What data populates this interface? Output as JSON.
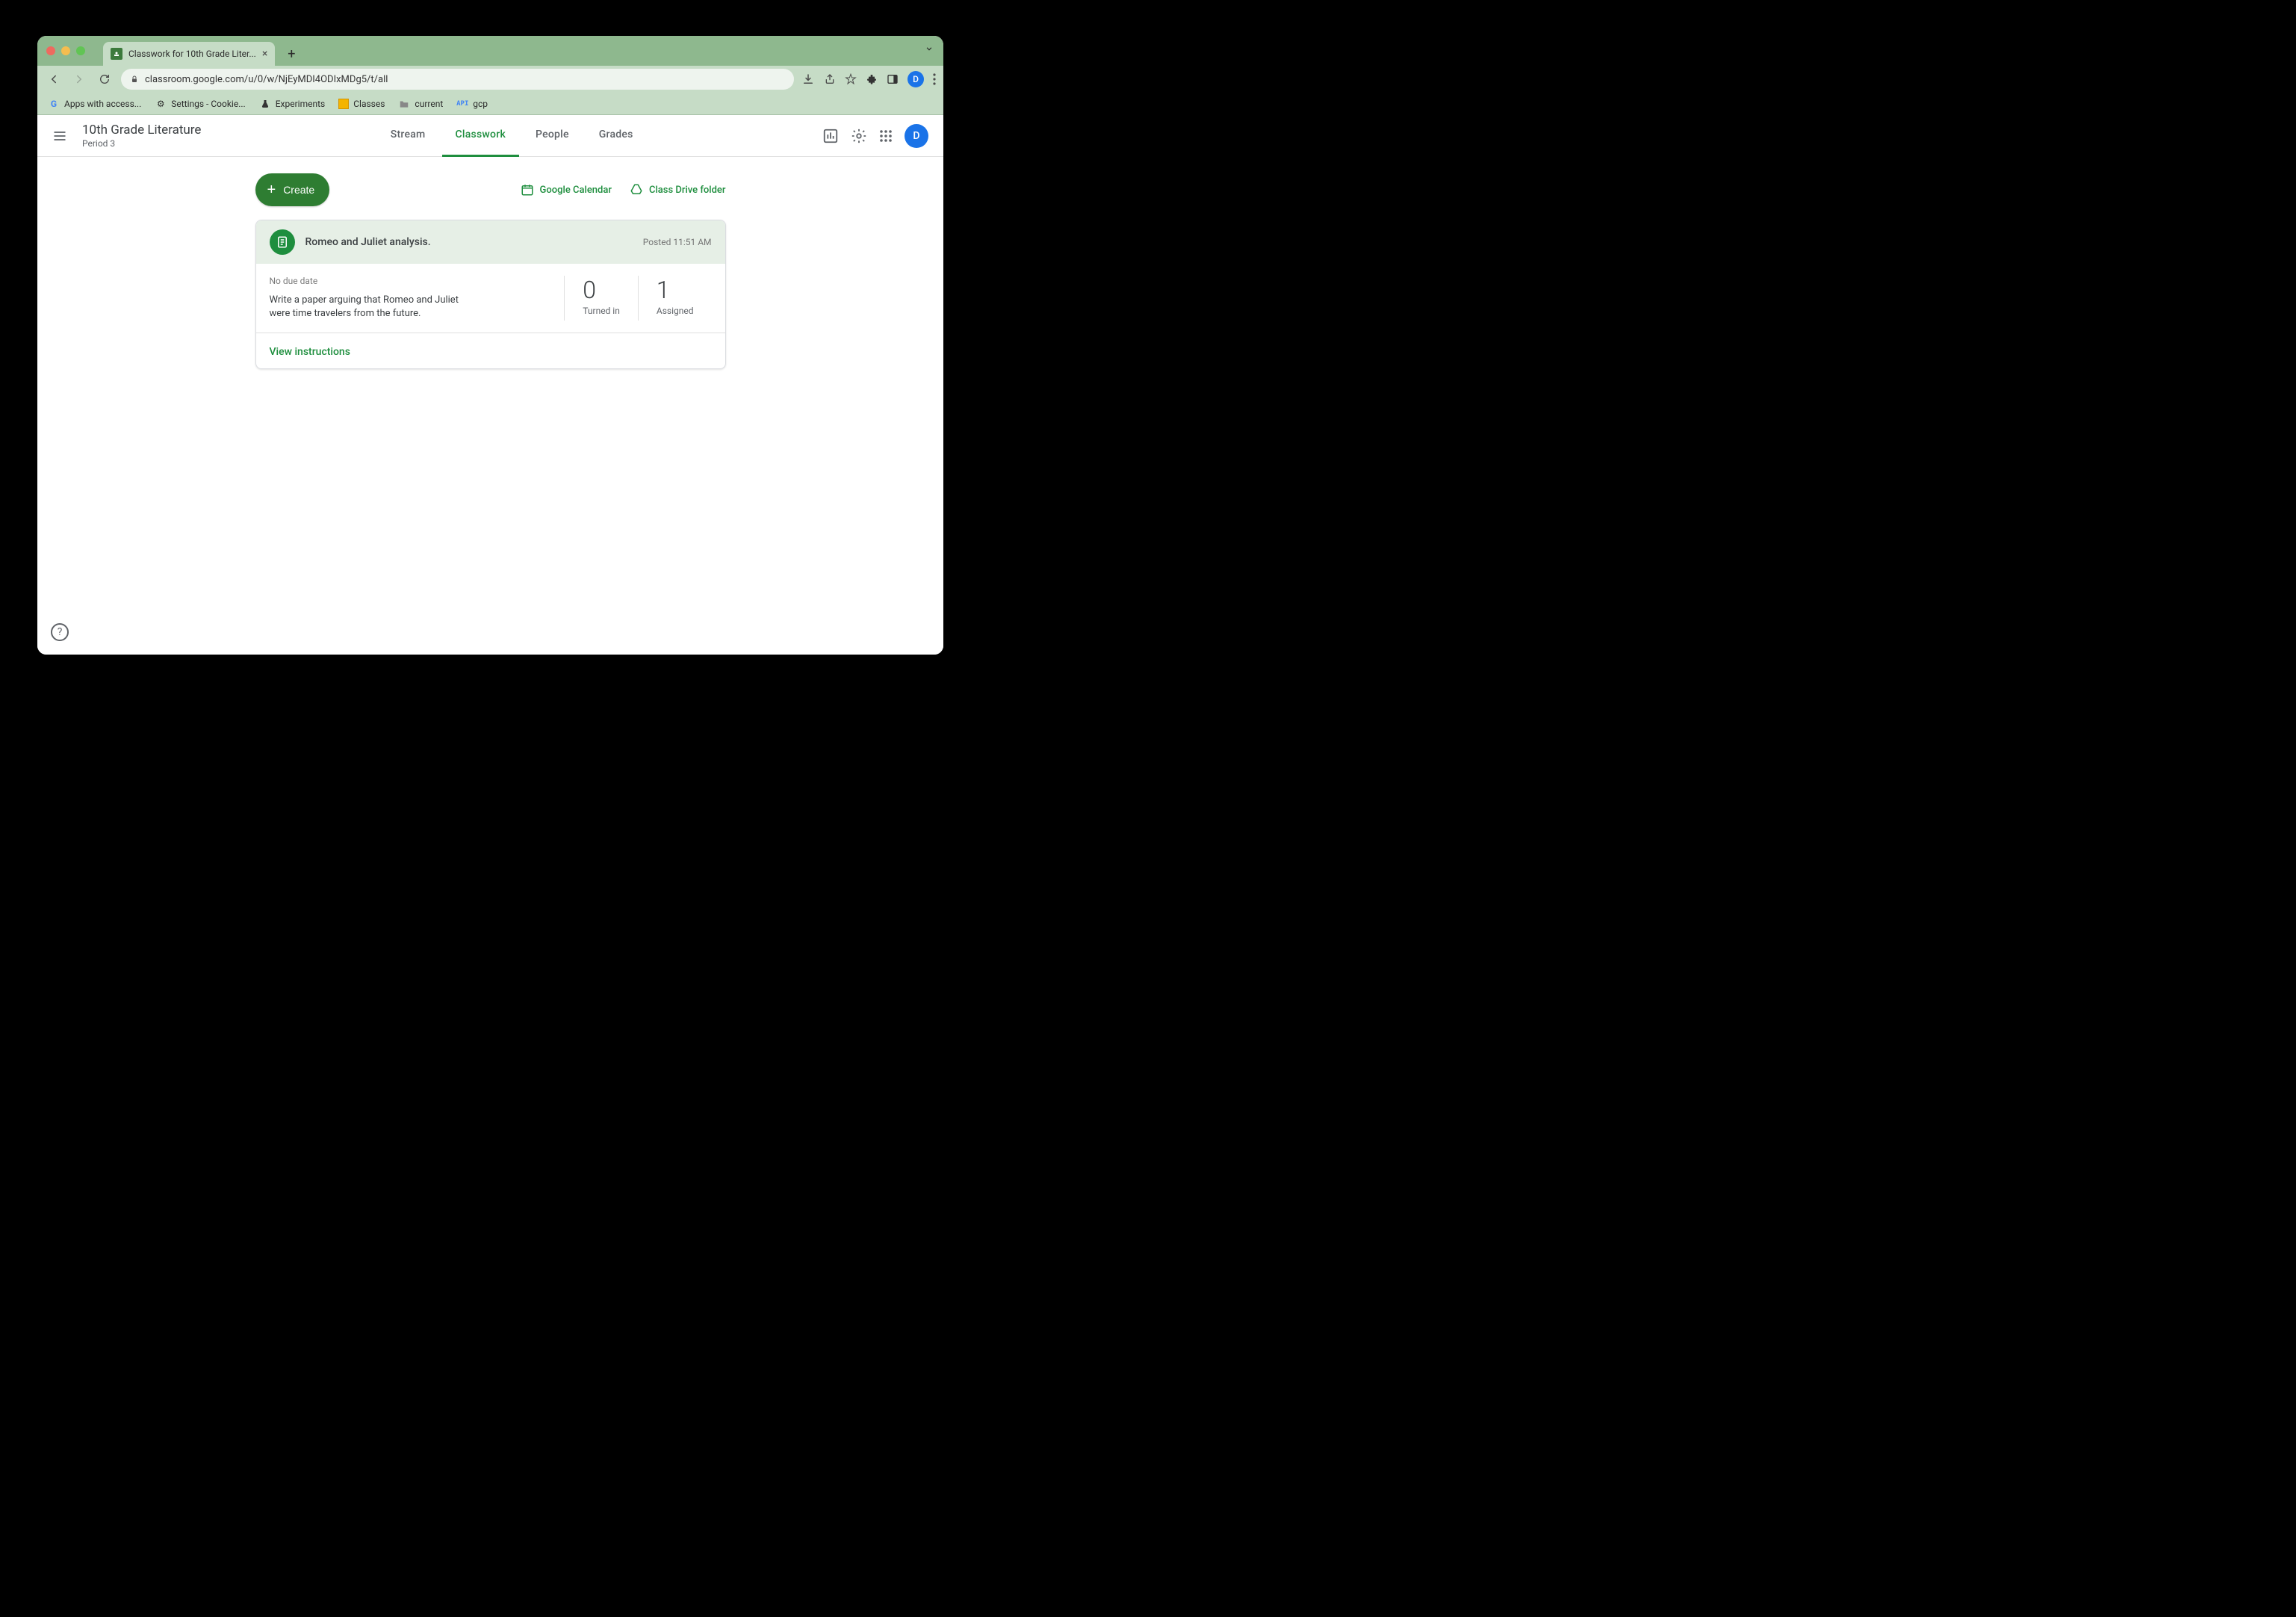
{
  "browser": {
    "tab_title": "Classwork for 10th Grade Liter...",
    "url": "classroom.google.com/u/0/w/NjEyMDI4ODIxMDg5/t/all",
    "avatar_letter": "D"
  },
  "bookmarks": [
    {
      "label": "Apps with access...",
      "icon": "G",
      "color": "#4285f4"
    },
    {
      "label": "Settings - Cookie...",
      "icon": "⚙",
      "color": "#333"
    },
    {
      "label": "Experiments",
      "icon": "⚗",
      "color": "#333"
    },
    {
      "label": "Classes",
      "icon": "▦",
      "color": "#f4b400"
    },
    {
      "label": "current",
      "icon": "▭",
      "color": "#888"
    },
    {
      "label": "gcp",
      "icon": "API",
      "color": "#4285f4"
    }
  ],
  "header": {
    "class_name": "10th Grade Literature",
    "class_sub": "Period 3",
    "tabs": [
      "Stream",
      "Classwork",
      "People",
      "Grades"
    ],
    "active_tab": 1,
    "avatar_letter": "D"
  },
  "toolbar": {
    "create_label": "Create",
    "links": [
      {
        "label": "Google Calendar"
      },
      {
        "label": "Class Drive folder"
      }
    ]
  },
  "assignment": {
    "title": "Romeo and Juliet analysis.",
    "posted": "Posted 11:51 AM",
    "due": "No due date",
    "description": "Write a paper arguing that Romeo and Juliet were time travelers from the future.",
    "stats": [
      {
        "count": "0",
        "label": "Turned in"
      },
      {
        "count": "1",
        "label": "Assigned"
      }
    ],
    "view_label": "View instructions"
  }
}
